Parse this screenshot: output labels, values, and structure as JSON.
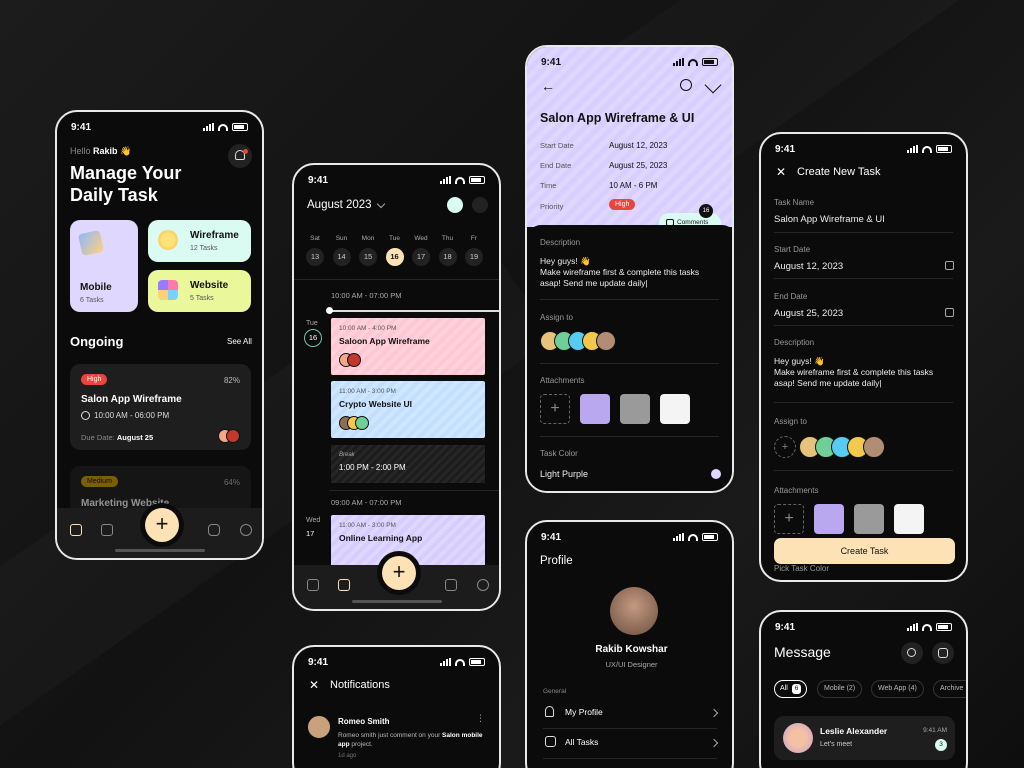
{
  "status_time": "9:41",
  "colors": {
    "accent": "#fde2b5",
    "purple": "#e0d7ff",
    "mint": "#d9fbf1",
    "yellow": "#eaf79a",
    "pink": "#ffd1dc",
    "blue": "#cfe6ff",
    "high": "#e8453c",
    "medium": "#d9a200"
  },
  "home": {
    "greeting": "Hello",
    "user": "Rakib",
    "wave": "👋",
    "title_line1": "Manage Your",
    "title_line2": "Daily Task",
    "categories": [
      {
        "name": "Mobile",
        "tasks": "6 Tasks"
      },
      {
        "name": "Wireframe",
        "tasks": "12 Tasks"
      },
      {
        "name": "Website",
        "tasks": "5 Tasks"
      }
    ],
    "ongoing": "Ongoing",
    "see_all": "See All",
    "task": {
      "priority": "High",
      "percent": "82%",
      "title": "Salon App Wireframe",
      "time": "10:00 AM - 06:00 PM",
      "due_label": "Due Date:",
      "due": "August 25"
    },
    "task2": {
      "priority": "Medium",
      "percent": "64%",
      "title": "Marketing Website"
    }
  },
  "calendar": {
    "month": "August 2023",
    "days": [
      "Sat",
      "Sun",
      "Mon",
      "Tue",
      "Wed",
      "Thu",
      "Fr"
    ],
    "dates": [
      "13",
      "14",
      "15",
      "16",
      "17",
      "18",
      "19"
    ],
    "range1": "10:00 AM - 07:00 PM",
    "tue_day": "Tue",
    "tue_date": "16",
    "events": [
      {
        "time": "10:00 AM - 4:00 PM",
        "title": "Saloon App Wireframe"
      },
      {
        "time": "11:00 AM - 3:00 PM",
        "title": "Crypto Website UI"
      }
    ],
    "break_label": "Break",
    "break_time": "1:00 PM - 2:00 PM",
    "range2": "09:00 AM - 07:00 PM",
    "wed_day": "Wed",
    "wed_date": "17",
    "event3": {
      "time": "11:00 AM - 3:00 PM",
      "title": "Online Learning App"
    }
  },
  "detail": {
    "title": "Salon App Wireframe & UI",
    "start_label": "Start Date",
    "start": "August 12, 2023",
    "end_label": "End Date",
    "end": "August 25, 2023",
    "time_label": "Time",
    "time": "10 AM - 6 PM",
    "priority_label": "Priority",
    "priority": "High",
    "comments": "Comments",
    "comments_count": "16",
    "desc_label": "Description",
    "desc1": "Hey guys! 👋",
    "desc2": "Make wireframe first & complete this tasks",
    "desc3": "asap! Send me update daily|",
    "assign_label": "Assign to",
    "attach_label": "Attachments",
    "color_label": "Task Color",
    "color_value": "Light Purple"
  },
  "create": {
    "title": "Create New Task",
    "name_label": "Task Name",
    "name": "Salon App Wireframe & UI",
    "start_label": "Start Date",
    "start": "August 12, 2023",
    "end_label": "End Date",
    "end": "August 25, 2023",
    "desc_label": "Description",
    "desc1": "Hey guys! 👋",
    "desc2": "Make wireframe first & complete this tasks",
    "desc3": "asap! Send me update daily|",
    "assign_label": "Assign to",
    "attach_label": "Attachments",
    "button": "Create Task",
    "pick_color": "Pick Task Color"
  },
  "notifications": {
    "title": "Notifications",
    "name": "Romeo Smith",
    "text1": "Romeo smith just comment on your",
    "bold1": "Salon",
    "bold2": "mobile app",
    "text2": "project.",
    "ago": "1d ago"
  },
  "profile": {
    "title": "Profile",
    "name": "Rakib Kowshar",
    "role": "UX/UI Designer",
    "section": "General",
    "items": [
      "My Profile",
      "All Tasks"
    ]
  },
  "message": {
    "title": "Message",
    "filters": [
      {
        "label": "All",
        "count": "6"
      },
      {
        "label": "Mobile",
        "count": "(2)"
      },
      {
        "label": "Web App",
        "count": "(4)"
      },
      {
        "label": "Archive",
        "count": ""
      }
    ],
    "chat": {
      "name": "Leslie Alexander",
      "text": "Let's meet",
      "time": "9:41 AM",
      "unread": "3"
    }
  }
}
